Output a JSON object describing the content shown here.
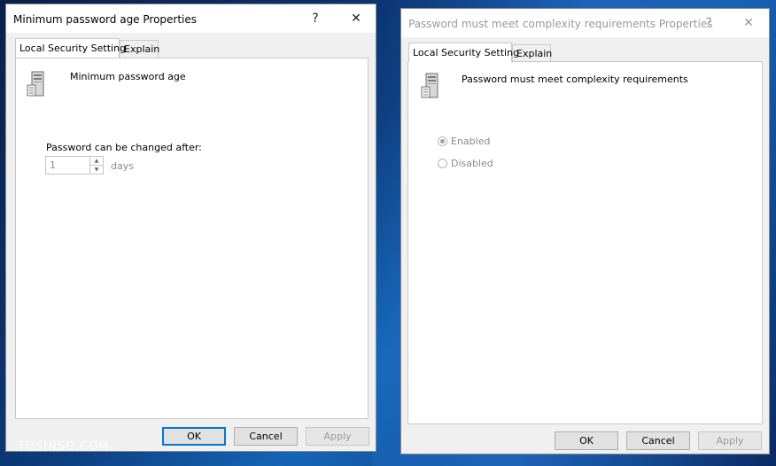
{
  "dialog1": {
    "title": "Minimum password age Properties",
    "help": "?",
    "close": "✕",
    "tabs": [
      {
        "label": "Local Security Setting",
        "active": true
      },
      {
        "label": "Explain",
        "active": false
      }
    ],
    "policy_name": "Minimum password age",
    "field_label": "Password can be changed after:",
    "field_value": "1",
    "unit": "days",
    "buttons": {
      "ok": "OK",
      "cancel": "Cancel",
      "apply": "Apply"
    }
  },
  "dialog2": {
    "title": "Password must meet complexity requirements Properties",
    "help": "?",
    "close": "✕",
    "tabs": [
      {
        "label": "Local Security Setting",
        "active": true
      },
      {
        "label": "Explain",
        "active": false
      }
    ],
    "policy_name": "Password must meet complexity requirements",
    "options": [
      {
        "label": "Enabled",
        "selected": true
      },
      {
        "label": "Disabled",
        "selected": false
      }
    ],
    "buttons": {
      "ok": "OK",
      "cancel": "Cancel",
      "apply": "Apply"
    }
  },
  "watermark": "TOSINSO.COM",
  "colors": {
    "accent": "#0078d7",
    "disabled_text": "#8a8a8a",
    "panel_bg": "#ffffff",
    "dialog_bg": "#f0f0f0"
  }
}
